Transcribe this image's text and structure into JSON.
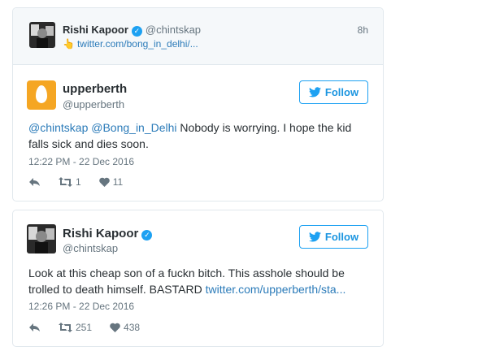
{
  "quoted": {
    "name": "Rishi Kapoor",
    "handle": "@chintskap",
    "time": "8h",
    "link": "twitter.com/bong_in_delhi/..."
  },
  "tweet1": {
    "name": "upperberth",
    "handle": "@upperberth",
    "follow_label": "Follow",
    "mention1": "@chintskap",
    "mention2": "@Bong_in_Delhi",
    "text": " Nobody is worrying. I hope the kid falls sick and dies soon.",
    "timestamp": "12:22 PM - 22 Dec 2016",
    "retweets": "1",
    "likes": "11"
  },
  "tweet2": {
    "name": "Rishi Kapoor",
    "handle": "@chintskap",
    "follow_label": "Follow",
    "text": "Look at this cheap son of a fuckn bitch. This asshole should be trolled to death himself. BASTARD ",
    "link": "twitter.com/upperberth/sta...",
    "timestamp": "12:26 PM - 22 Dec 2016",
    "retweets": "251",
    "likes": "438"
  },
  "colors": {
    "link": "#2b7bb9",
    "follow": "#1da1f2",
    "egg_avatar": "#f5a623",
    "muted": "#66757f"
  },
  "icons": [
    "reply-icon",
    "retweet-icon",
    "heart-icon",
    "twitter-bird-icon",
    "verified-icon",
    "pointing-hand-icon"
  ]
}
